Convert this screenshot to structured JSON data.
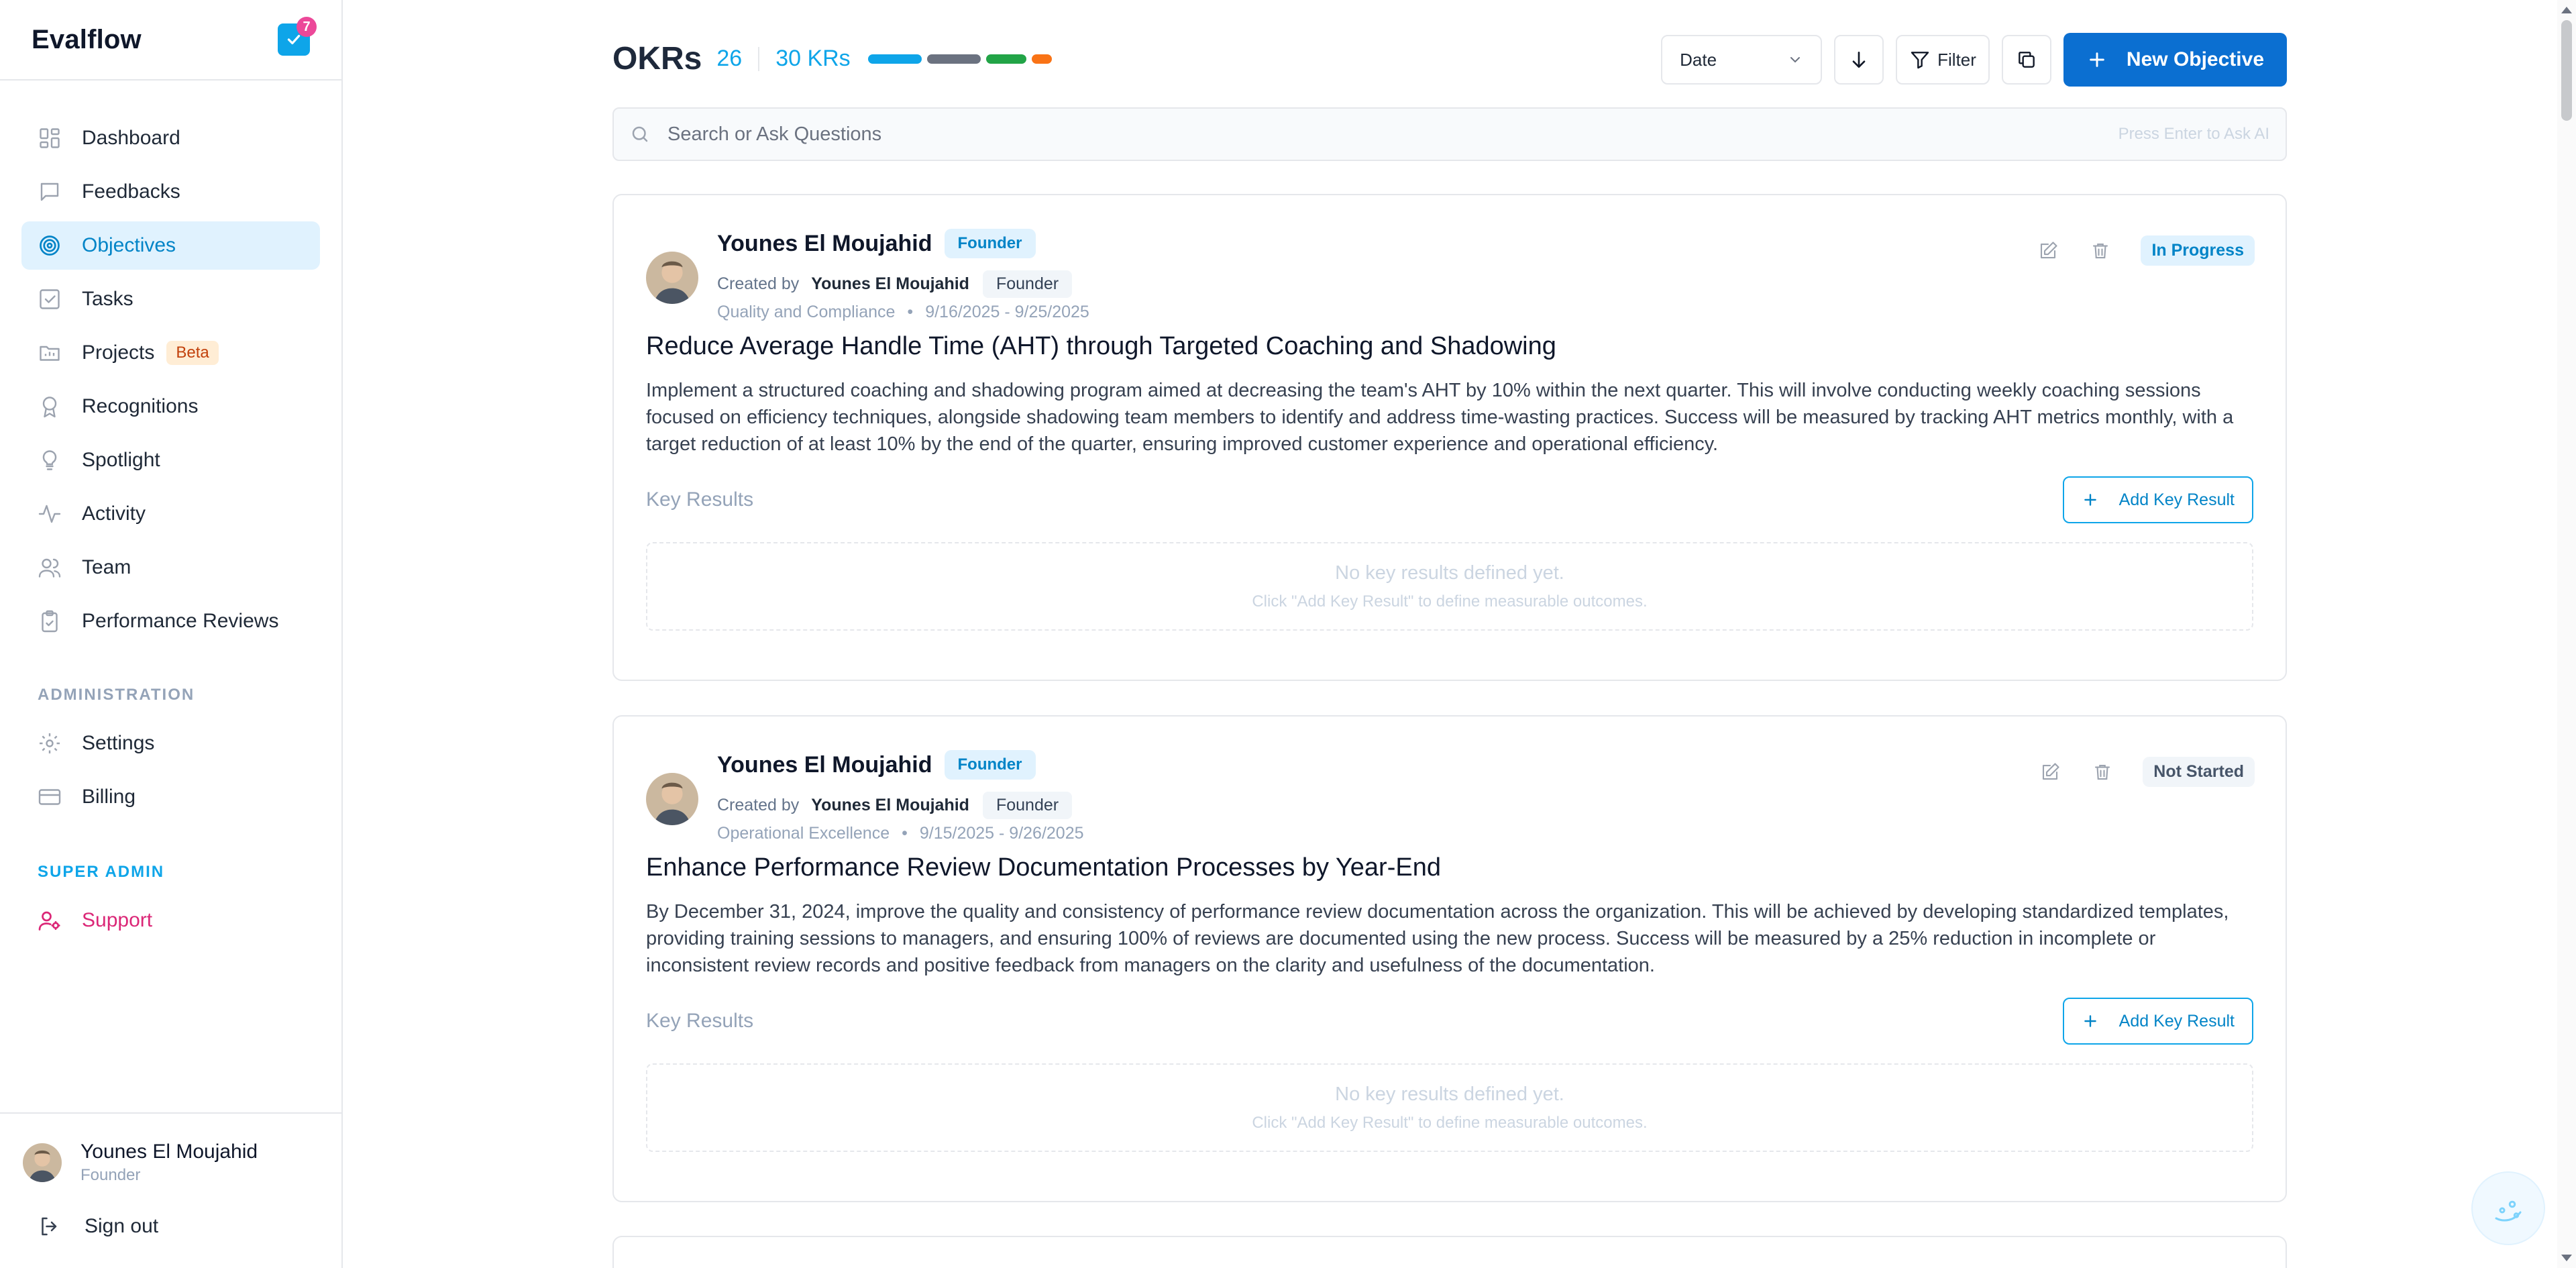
{
  "brand": {
    "name": "Evalflow",
    "notification_count": "7"
  },
  "sidebar": {
    "items": [
      {
        "label": "Dashboard",
        "icon": "dashboard-icon"
      },
      {
        "label": "Feedbacks",
        "icon": "message-icon"
      },
      {
        "label": "Objectives",
        "icon": "target-icon",
        "active": true
      },
      {
        "label": "Tasks",
        "icon": "checkbox-icon"
      },
      {
        "label": "Projects",
        "icon": "folder-icon",
        "badge": "Beta"
      },
      {
        "label": "Recognitions",
        "icon": "award-icon"
      },
      {
        "label": "Spotlight",
        "icon": "lightbulb-icon"
      },
      {
        "label": "Activity",
        "icon": "activity-icon"
      },
      {
        "label": "Team",
        "icon": "users-icon"
      },
      {
        "label": "Performance Reviews",
        "icon": "clipboard-icon"
      }
    ],
    "admin_label": "ADMINISTRATION",
    "admin_items": [
      {
        "label": "Settings",
        "icon": "gear-icon"
      },
      {
        "label": "Billing",
        "icon": "credit-card-icon"
      }
    ],
    "super_admin_label": "SUPER ADMIN",
    "super_items": [
      {
        "label": "Support",
        "icon": "user-gear-icon"
      }
    ]
  },
  "user": {
    "name": "Younes El Moujahid",
    "role": "Founder",
    "signout": "Sign out"
  },
  "header": {
    "title": "OKRs",
    "okr_count": "26",
    "kr_count": "30 KRs",
    "progress_colors": [
      "#0ea5e9",
      "#6b7280",
      "#22a447",
      "#f97316"
    ],
    "sort_label": "Date",
    "filter_label": "Filter",
    "new_objective_label": "New Objective"
  },
  "search": {
    "placeholder": "Search or Ask Questions",
    "hint": "Press Enter to Ask AI"
  },
  "objectives": [
    {
      "owner": "Younes El Moujahid",
      "owner_role": "Founder",
      "created_by_label": "Created by",
      "creator": "Younes El Moujahid",
      "creator_role": "Founder",
      "category": "Quality and Compliance",
      "dates": "9/16/2025 - 9/25/2025",
      "status": "In Progress",
      "title": "Reduce Average Handle Time (AHT) through Targeted Coaching and Shadowing",
      "description": "Implement a structured coaching and shadowing program aimed at decreasing the team's AHT by 10% within the next quarter. This will involve conducting weekly coaching sessions focused on efficiency techniques, alongside shadowing team members to identify and address time-wasting practices. Success will be measured by tracking AHT metrics monthly, with a target reduction of at least 10% by the end of the quarter, ensuring improved customer experience and operational efficiency.",
      "kr_label": "Key Results",
      "add_kr_label": "Add Key Result",
      "empty_title": "No key results defined yet.",
      "empty_hint": "Click \"Add Key Result\" to define measurable outcomes."
    },
    {
      "owner": "Younes El Moujahid",
      "owner_role": "Founder",
      "created_by_label": "Created by",
      "creator": "Younes El Moujahid",
      "creator_role": "Founder",
      "category": "Operational Excellence",
      "dates": "9/15/2025 - 9/26/2025",
      "status": "Not Started",
      "title": "Enhance Performance Review Documentation Processes by Year-End",
      "description": "By December 31, 2024, improve the quality and consistency of performance review documentation across the organization. This will be achieved by developing standardized templates, providing training sessions to managers, and ensuring 100% of reviews are documented using the new process. Success will be measured by a 25% reduction in incomplete or inconsistent review records and positive feedback from managers on the clarity and usefulness of the documentation.",
      "kr_label": "Key Results",
      "add_kr_label": "Add Key Result",
      "empty_title": "No key results defined yet.",
      "empty_hint": "Click \"Add Key Result\" to define measurable outcomes."
    }
  ]
}
